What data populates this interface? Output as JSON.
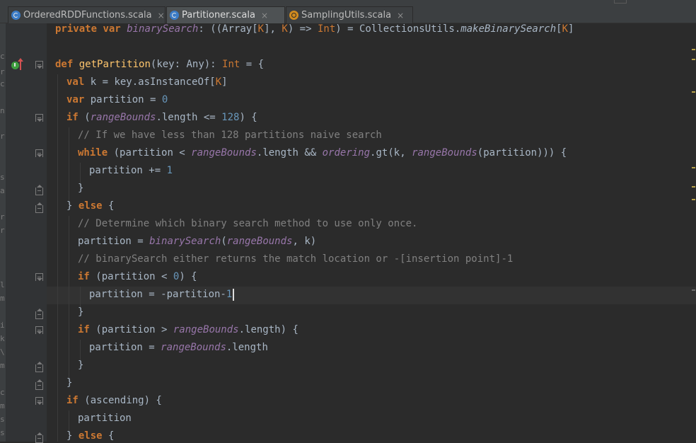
{
  "tabs": [
    {
      "label": "OrderedRDDFunctions.scala",
      "icon": "class-icon",
      "active": false,
      "close": "×"
    },
    {
      "label": "Partitioner.scala",
      "icon": "class-icon",
      "active": true,
      "close": "×"
    },
    {
      "label": "SamplingUtils.scala",
      "icon": "object-icon",
      "active": false,
      "close": "×"
    }
  ],
  "left_panel_chars": [
    "c",
    "r",
    "c",
    "n",
    "r",
    "s",
    "a",
    "r",
    "r",
    "l",
    "m",
    "i",
    "k",
    "\\",
    "m",
    "c",
    "m",
    "s",
    "s"
  ],
  "code": {
    "line1": {
      "a": "private",
      "b": " ",
      "c": "var",
      "d": " ",
      "e": "binarySearch",
      "f": ": ((Array[",
      "g": "K",
      "h": "], ",
      "i": "K",
      "j": ") => ",
      "k": "Int",
      "l": ") = CollectionsUtils.",
      "m": "makeBinarySearch",
      "n": "[",
      "o": "K",
      "p": "]"
    },
    "line3": {
      "a": "def",
      "b": " ",
      "c": "getPartition",
      "d": "(key: Any): ",
      "e": "Int",
      "f": " = {"
    },
    "line4": {
      "a": "val",
      "b": " k = key.asInstanceOf[",
      "c": "K",
      "d": "]"
    },
    "line5": {
      "a": "var",
      "b": " partition = ",
      "c": "0"
    },
    "line6": {
      "a": "if",
      "b": " (",
      "c": "rangeBounds",
      "d": ".length <= ",
      "e": "128",
      "f": ") {"
    },
    "line7": {
      "a": "// If we have less than 128 partitions naive search"
    },
    "line8": {
      "a": "while",
      "b": " (partition < ",
      "c": "rangeBounds",
      "d": ".length && ",
      "e": "ordering",
      "f": ".gt(k, ",
      "g": "rangeBounds",
      "h": "(partition))) {"
    },
    "line9": {
      "a": "partition += ",
      "b": "1"
    },
    "line10": {
      "a": "}"
    },
    "line11": {
      "a": "} ",
      "b": "else",
      "c": " {"
    },
    "line12": {
      "a": "// Determine which binary search method to use only once."
    },
    "line13": {
      "a": "partition = ",
      "b": "binarySearch",
      "c": "(",
      "d": "rangeBounds",
      "e": ", k)"
    },
    "line14": {
      "a": "// binarySearch either returns the match location or -[insertion point]-1"
    },
    "line15": {
      "a": "if",
      "b": " (partition < ",
      "c": "0",
      "d": ") {"
    },
    "line16": {
      "a": "partition = -partition-",
      "b": "1"
    },
    "line17": {
      "a": "}"
    },
    "line18": {
      "a": "if",
      "b": " (partition > ",
      "c": "rangeBounds",
      "d": ".length) {"
    },
    "line19": {
      "a": "partition = ",
      "b": "rangeBounds",
      "c": ".length"
    },
    "line20": {
      "a": "}"
    },
    "line21": {
      "a": "}"
    },
    "line22": {
      "a": "if",
      "b": " (ascending) {"
    },
    "line23": {
      "a": "partition"
    },
    "line24": {
      "a": "} ",
      "b": "else",
      "c": " {"
    }
  },
  "colors": {
    "background": "#2b2b2b",
    "keyword": "#cc7832",
    "function": "#ffc66d",
    "number": "#6897bb",
    "comment": "#808080",
    "field": "#9876aa",
    "text": "#a9b7c6",
    "caret_line": "#323232"
  }
}
